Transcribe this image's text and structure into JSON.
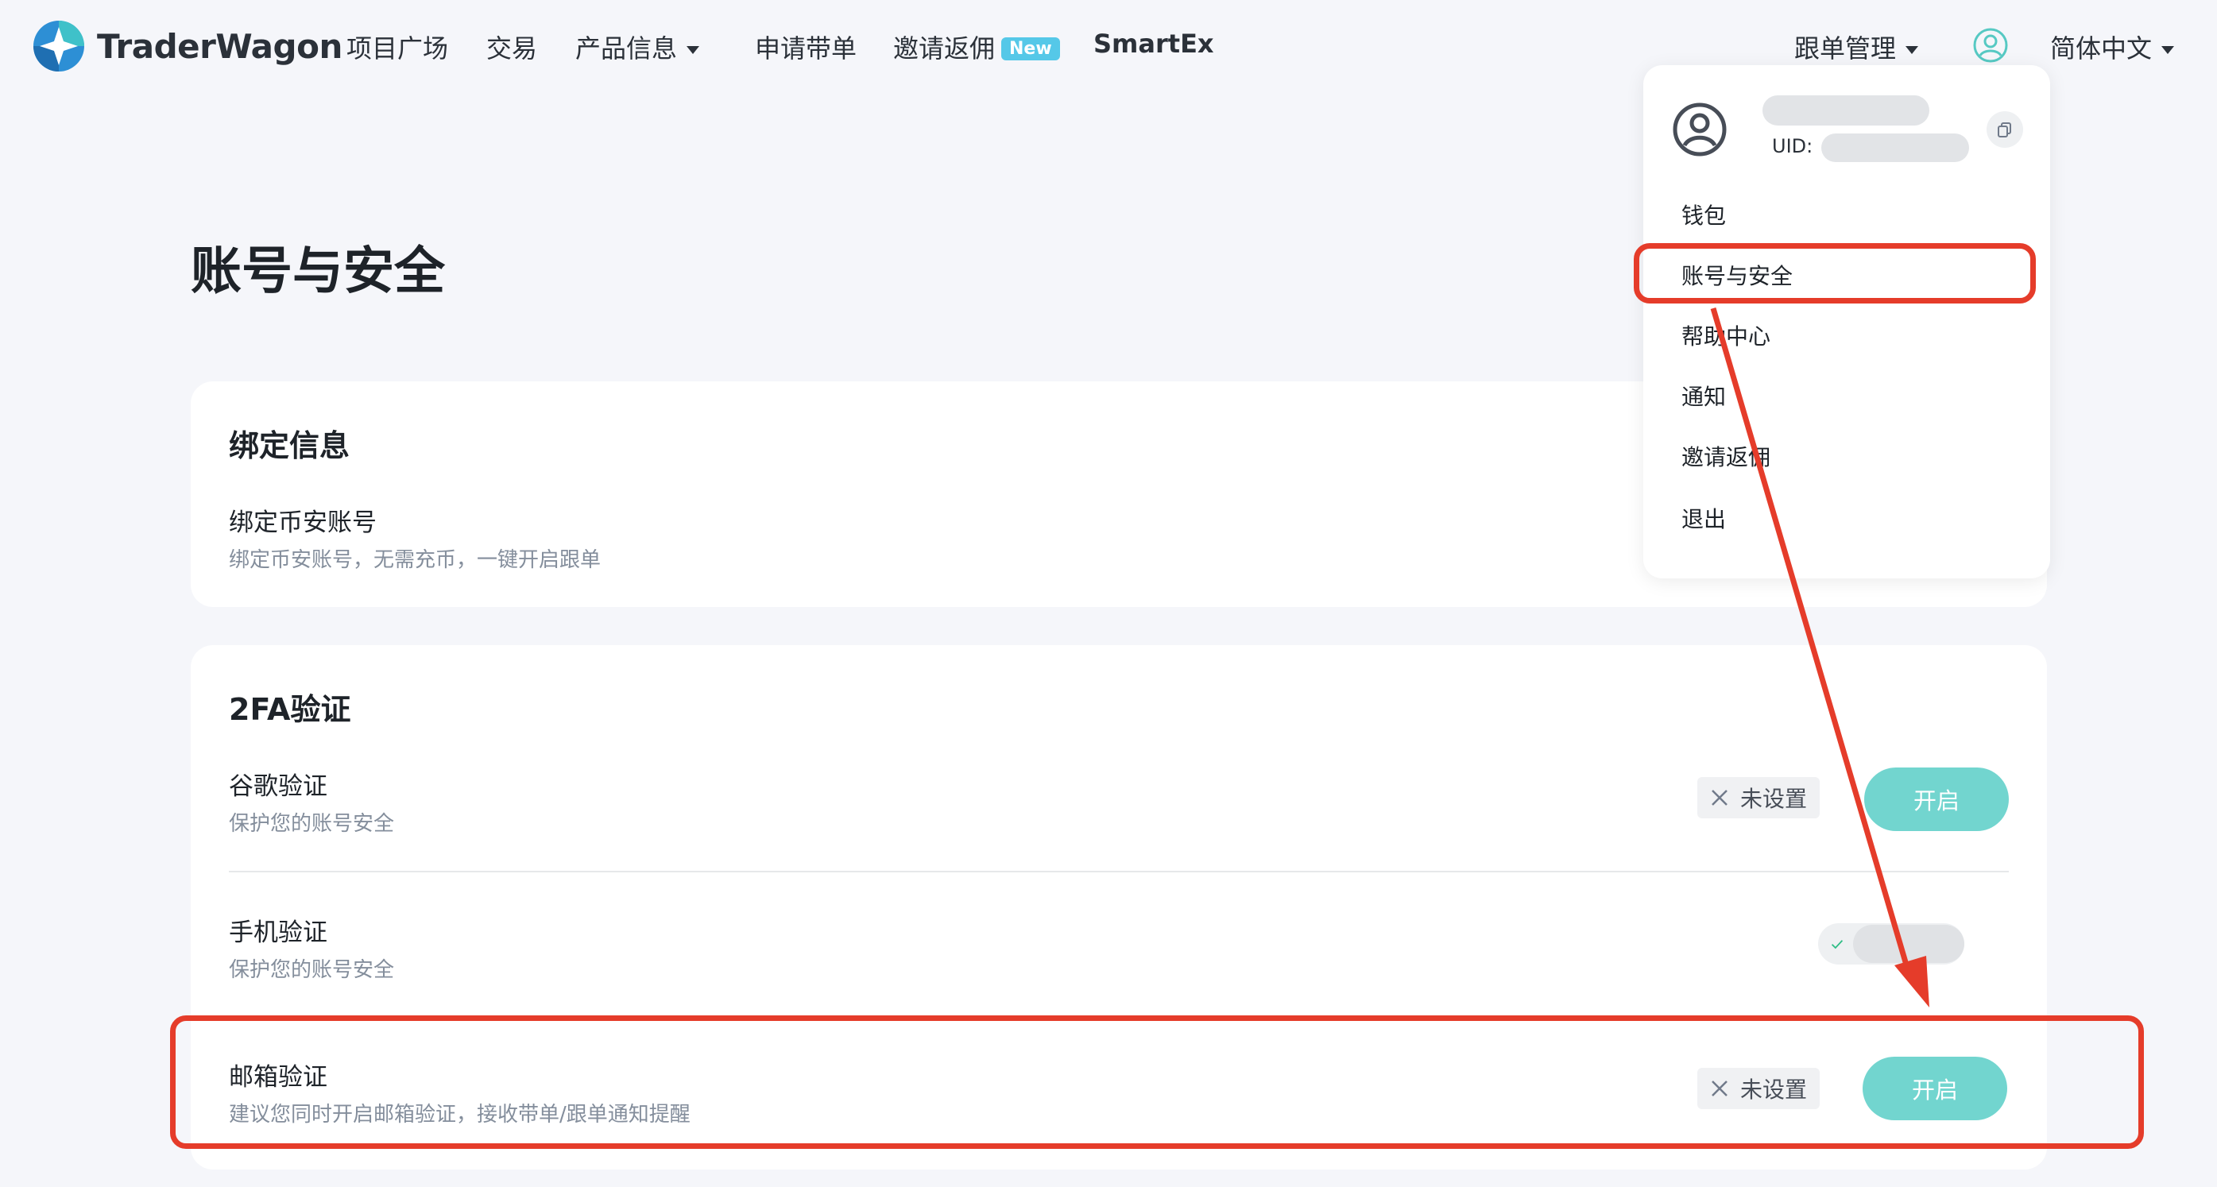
{
  "brand": {
    "name": "TraderWagon",
    "logo_icon": "traderwagon-logo-icon"
  },
  "nav": {
    "items": [
      "项目广场",
      "交易",
      "产品信息",
      "申请带单",
      "邀请返佣",
      "SmartEx"
    ],
    "new_badge": "New",
    "copy_manage": "跟单管理",
    "language": "简体中文"
  },
  "page": {
    "title": "账号与安全"
  },
  "binding": {
    "title": "绑定信息",
    "label": "绑定币安账号",
    "desc": "绑定币安账号，无需充币，一键开启跟单"
  },
  "twofa": {
    "title": "2FA验证",
    "rows": [
      {
        "label": "谷歌验证",
        "desc": "保护您的账号安全",
        "status": "未设置",
        "action": "开启"
      },
      {
        "label": "手机验证",
        "desc": "保护您的账号安全"
      },
      {
        "label": "邮箱验证",
        "desc": "建议您同时开启邮箱验证，接收带单/跟单通知提醒",
        "status": "未设置",
        "action": "开启"
      }
    ]
  },
  "dropdown": {
    "uid_label": "UID: ",
    "items": [
      "钱包",
      "账号与安全",
      "帮助中心",
      "通知",
      "邀请返佣",
      "退出"
    ]
  },
  "colors": {
    "accent_button": "#72d5cf",
    "annotation_red": "#e53c2a",
    "new_badge": "#55c8e8",
    "check_green": "#2ebd85"
  }
}
